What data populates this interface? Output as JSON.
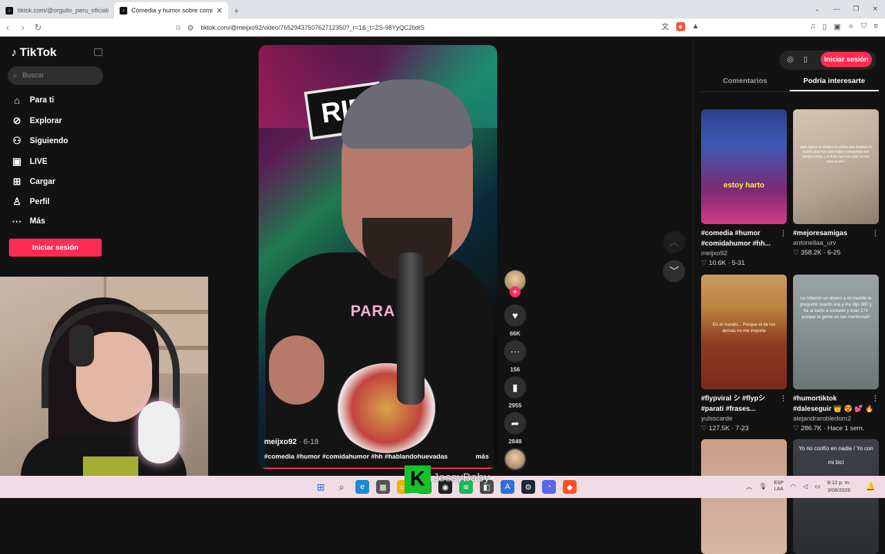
{
  "browser": {
    "tabs": [
      {
        "title": "tiktok.com/@orgullo_peru_oficial/vi",
        "active": false
      },
      {
        "title": "Comedia y humor sobre comida",
        "active": true
      }
    ],
    "url": "tiktok.com/@meijxo92/video/7652943750762712350?_r=1&_t=ZS-98YyQC2bdlS"
  },
  "sidebar": {
    "logo": "TikTok",
    "search_placeholder": "Buscar",
    "items": [
      {
        "label": "Para ti",
        "icon": "home-icon"
      },
      {
        "label": "Explorar",
        "icon": "compass-icon"
      },
      {
        "label": "Siguiendo",
        "icon": "following-icon"
      },
      {
        "label": "LIVE",
        "icon": "live-icon"
      },
      {
        "label": "Cargar",
        "icon": "upload-icon"
      },
      {
        "label": "Perfil",
        "icon": "profile-icon"
      },
      {
        "label": "Más",
        "icon": "more-icon"
      }
    ],
    "login_label": "Iniciar sesión"
  },
  "video": {
    "overlay_word": "PARA",
    "author": "meijxo92",
    "date": "6-18",
    "caption": "#comedia #humor #comidahumor #hh #hablandohuevadas",
    "more": "más",
    "actions": {
      "likes": "66K",
      "comments": "156",
      "saves": "2955",
      "shares": "2848"
    }
  },
  "right_panel": {
    "signin_label": "Iniciar sesión",
    "tabs": [
      "Comentarios",
      "Podría interesarte"
    ],
    "active_tab": 1,
    "cards": [
      {
        "caption1": "#comedia #humor",
        "caption2": "#comidahumor #hh...",
        "user": "meijxo92",
        "likes": "10.6K",
        "date": "5-31",
        "overlay": "estoy harto"
      },
      {
        "caption1": "#mejoresamigas",
        "caption2": "",
        "user": "antonellaa_urv",
        "likes": "358.2K",
        "date": "6-25",
        "overlay": "ojala nunca te olviden lo unidas que éramos, lo mucho que nos sanó haber compartido ese tiempo juntas y lo lindo que era estar la una para la otra."
      },
      {
        "caption1": "#flypviral シ #flypシ",
        "caption2": "#parati #frases...",
        "user": "yulsscarde",
        "likes": "127.5K",
        "date": "7-23",
        "overlay": "En el mundo... Porque el de los demás no me importa"
      },
      {
        "caption1": "#humortiktok",
        "caption2": "#daleseguir 👑 😍 💕 🔥",
        "user": "alejandrarobledom2",
        "likes": "286.7K",
        "date": "Hace 1 sem.",
        "overlay": "Le robaron un dinero a mi marido le pregunté cuanto era y me dijo 300 y fui al baño a contarlo y eran 170 porque la gente es tan mentirosa!!"
      },
      {
        "caption1": "",
        "caption2": "",
        "user": "",
        "likes": "",
        "date": "",
        "overlay": ""
      },
      {
        "caption1": "",
        "caption2": "",
        "user": "",
        "likes": "",
        "date": "",
        "overlay": "Yo no confío en nadie / Yo con mi bici"
      }
    ]
  },
  "stream_overlay": {
    "badge": "K",
    "name": "JessyBaby"
  },
  "taskbar": {
    "lang1": "ESP",
    "lang2": "LAA",
    "time": "8:12 p. m.",
    "date": "3/08/2026"
  }
}
